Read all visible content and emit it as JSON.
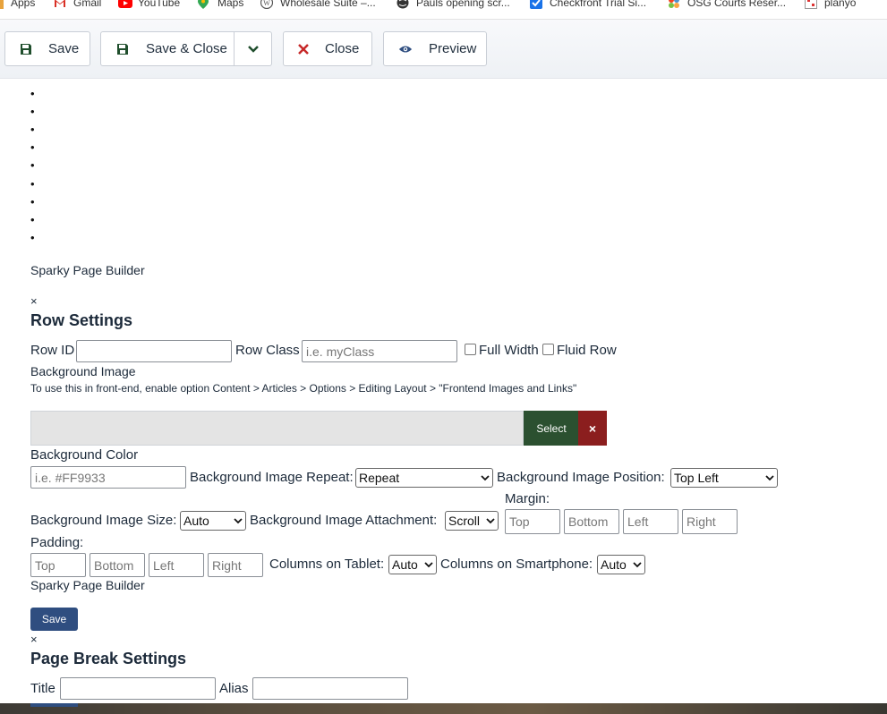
{
  "bookmarks": [
    {
      "label": "Apps",
      "icon": "apps-grid-icon"
    },
    {
      "label": "Gmail",
      "icon": "gmail-icon"
    },
    {
      "label": "YouTube",
      "icon": "youtube-icon"
    },
    {
      "label": "Maps",
      "icon": "maps-icon"
    },
    {
      "label": "Wholesale Suite –...",
      "icon": "wordpress-icon"
    },
    {
      "label": "Pauls opening scr...",
      "icon": "globe-icon"
    },
    {
      "label": "Checkfront Trial Si...",
      "icon": "checkfront-icon"
    },
    {
      "label": "OSG Courts Reser...",
      "icon": "joomla-icon"
    },
    {
      "label": "planyo",
      "icon": "planyo-icon"
    }
  ],
  "toolbar": {
    "save_label": "Save",
    "save_close_label": "Save & Close",
    "close_label": "Close",
    "preview_label": "Preview"
  },
  "bullets": [
    "•",
    "•",
    "•",
    "•",
    "•",
    "•",
    "•",
    "•",
    "•"
  ],
  "builder_title": "Sparky Page Builder",
  "builder_title_2": "Sparky Page Builder",
  "close_x": "×",
  "close_x_2": "×",
  "row_settings": {
    "heading": "Row Settings",
    "row_id_label": "Row ID",
    "row_id_value": "",
    "row_class_label": "Row Class",
    "row_class_placeholder": "i.e. myClass",
    "full_width_label": "Full Width",
    "fluid_row_label": "Fluid Row",
    "bg_image_label": "Background Image",
    "bg_image_hint": "To use this in front-end, enable option Content > Articles > Options > Editing Layout > \"Frontend Images and Links\"",
    "select_label": "Select",
    "clear_label": "×",
    "bg_color_label": "Background Color",
    "bg_color_placeholder": "i.e. #FF9933",
    "bg_repeat_label": "Background Image Repeat:",
    "bg_repeat_value": "Repeat",
    "bg_position_label": "Background Image Position:",
    "bg_position_value": "Top Left",
    "bg_size_label": "Background Image Size:",
    "bg_size_value": "Auto",
    "bg_attachment_label": "Background Image Attachment:",
    "bg_attachment_value": "Scroll",
    "margin_label": "Margin:",
    "margin_top": "Top",
    "margin_bottom": "Bottom",
    "margin_left": "Left",
    "margin_right": "Right",
    "padding_label": "Padding:",
    "padding_top": "Top",
    "padding_bottom": "Bottom",
    "padding_left": "Left",
    "padding_right": "Right",
    "cols_tablet_label": "Columns on Tablet:",
    "cols_tablet_value": "Auto",
    "cols_phone_label": "Columns on Smartphone:",
    "cols_phone_value": "Auto",
    "save_label": "Save"
  },
  "page_break": {
    "heading": "Page Break Settings",
    "title_label": "Title",
    "alias_label": "Alias"
  },
  "colors": {
    "select_button": "#2b5030",
    "clear_button": "#8b1e1e",
    "save_button": "#2f4e80"
  }
}
